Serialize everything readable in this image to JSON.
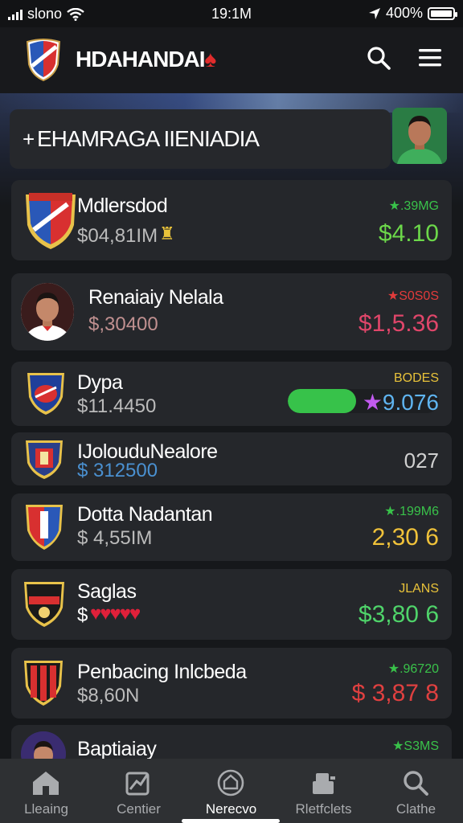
{
  "status_bar": {
    "carrier": "slono",
    "time": "19:1M",
    "battery": "400%"
  },
  "header": {
    "app_title": "HDAHANDAI",
    "search_icon": "search-icon",
    "menu_icon": "menu-icon"
  },
  "featured": {
    "prefix": "+",
    "title": "EHAMRAGA IIENIADIA"
  },
  "items": [
    {
      "name": "Mdlersdod",
      "price": "$04,81IM",
      "tag": "",
      "tag_icon": "star-icon",
      "tag_color": "#39c24a",
      "tag_text": ".39MG",
      "value": "$4.10",
      "value_color": "#6cd84a"
    },
    {
      "name": "Renaiaiy Nelala",
      "price": "$,30400",
      "tag_text": "S0S0S",
      "tag_color": "#e23b3b",
      "value": "$1,5.36",
      "value_color": "#e0466a"
    },
    {
      "name": "Dypa",
      "price": "$11.4450",
      "tag_text": "BODES",
      "tag_color": "#e8c23a",
      "value": "9.076",
      "value_color": "#5fb4f0",
      "progress": 0.45
    },
    {
      "name": "IJolouduNealore",
      "price": "$ 312500",
      "tag_text": "",
      "value": "027",
      "value_color": "#d0d0d0"
    },
    {
      "name": "Dotta Nadantan",
      "price": "$ 4,55IM",
      "tag_text": ".199M6",
      "tag_color": "#39c24a",
      "value": "2,30 6",
      "value_color": "#f0c23a"
    },
    {
      "name": "Saglas",
      "price": "$",
      "tag_text": "JLANS",
      "tag_color": "#e8c23a",
      "value": "$3,80 6",
      "value_color": "#4fd46a"
    },
    {
      "name": "Penbacing Inlcbeda",
      "price": "$8,60N",
      "tag_text": ".96720",
      "tag_color": "#39c24a",
      "value": "$ 3,87 8",
      "value_color": "#e04040"
    },
    {
      "name": "Baptiaiay",
      "price": "",
      "tag_text": "S3MS",
      "tag_color": "#39c24a",
      "value": "",
      "value_color": "#fff"
    }
  ],
  "nav": [
    {
      "label": "Lleaing",
      "icon": "home-icon"
    },
    {
      "label": "Centier",
      "icon": "chart-icon"
    },
    {
      "label": "Nerecvo",
      "icon": "shield-icon"
    },
    {
      "label": "Rletfclets",
      "icon": "profile-card-icon"
    },
    {
      "label": "Clathe",
      "icon": "search-icon"
    }
  ]
}
